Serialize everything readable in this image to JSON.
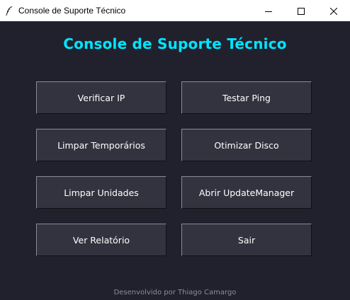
{
  "window": {
    "title": "Console de Suporte Técnico",
    "app_icon": "feather-icon",
    "controls": {
      "minimize_icon": "minimize-icon",
      "maximize_icon": "maximize-icon",
      "close_icon": "close-icon"
    }
  },
  "header": {
    "title": "Console de Suporte Técnico"
  },
  "buttons": {
    "verificar_ip": "Verificar IP",
    "testar_ping": "Testar Ping",
    "limpar_temporarios": "Limpar Temporários",
    "otimizar_disco": "Otimizar Disco",
    "limpar_unidades": "Limpar Unidades",
    "abrir_updatemanager": "Abrir UpdateManager",
    "ver_relatorio": "Ver Relatório",
    "sair": "Sair"
  },
  "footer": {
    "credit": "Desenvolvido por Thiago Camargo"
  },
  "colors": {
    "background": "#21212e",
    "button_bg": "#33333f",
    "title_accent": "#00e5ff",
    "footer_text": "#8c8c94"
  }
}
